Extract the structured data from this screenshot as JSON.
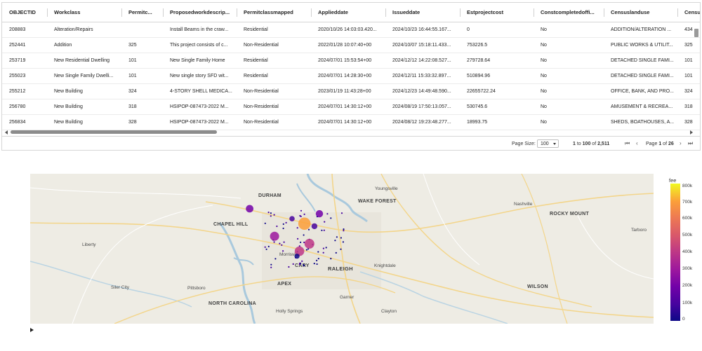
{
  "grid": {
    "columns": [
      "OBJECTID",
      "Workclass",
      "Permitc...",
      "Proposedworkdescrip...",
      "Permitclassmapped",
      "Applieddate",
      "Issueddate",
      "Estprojectcost",
      "Constcompletedoffi...",
      "Censuslanduse",
      "Censusl"
    ],
    "rows": [
      [
        "208883",
        "Alteration/Repairs",
        "",
        "Install Beams in the craw...",
        "Residential",
        "2020/10/26 14:03:03.420...",
        "2024/10/23 16:44:55.167...",
        "0",
        "No",
        "ADDITION/ALTERATION ...",
        "434"
      ],
      [
        "252441",
        "Addition",
        "325",
        "This project consists of c...",
        "Non-Residential",
        "2022/01/28 10:07:40+00",
        "2024/10/07 15:18:11.433...",
        "753226.5",
        "No",
        "PUBLIC WORKS & UTILIT...",
        "325"
      ],
      [
        "253719",
        "New Residential Dwelling",
        "101",
        "New Single Family Home",
        "Residential",
        "2024/07/01 15:53:54+00",
        "2024/12/12 14:22:08.527...",
        "279728.64",
        "No",
        "DETACHED SINGLE FAMI...",
        "101"
      ],
      [
        "255023",
        "New Single Family Dwelli...",
        "101",
        "New single story SFD wit...",
        "Residential",
        "2024/07/01 14:28:30+00",
        "2024/12/11 15:33:32.897...",
        "510894.96",
        "No",
        "DETACHED SINGLE FAMI...",
        "101"
      ],
      [
        "255212",
        "New Building",
        "324",
        "4-STORY SHELL MEDICA...",
        "Non-Residential",
        "2023/01/19 11:43:28+00",
        "2024/12/23 14:49:48.590...",
        "22655722.24",
        "No",
        "OFFICE, BANK, AND PRO...",
        "324"
      ],
      [
        "256780",
        "New Building",
        "318",
        "HSIPOP-087473-2022 M...",
        "Non-Residential",
        "2024/07/01 14:30:12+00",
        "2024/08/19 17:50:13.057...",
        "530745.6",
        "No",
        "AMUSEMENT & RECREA...",
        "318"
      ],
      [
        "256834",
        "New Building",
        "328",
        "HSIPOP-087473-2022 M...",
        "Non-Residential",
        "2024/07/01 14:30:12+00",
        "2024/08/12 19:23:48.277...",
        "18993.75",
        "No",
        "SHEDS, BOATHOUSES, A...",
        "328"
      ]
    ],
    "pager": {
      "page_size_label": "Page Size:",
      "page_size_value": "100",
      "range_from": "1",
      "range_to": "100",
      "range_of_word": "of",
      "range_to_word": "to",
      "total": "2,511",
      "page_word": "Page",
      "page_current": "1",
      "page_of_word": "of",
      "page_total": "26"
    }
  },
  "map": {
    "labels": {
      "durham": "DURHAM",
      "wake_forest": "WAKE FOREST",
      "youngsville": "Youngsville",
      "nashville": "Nashville",
      "rocky_mount": "ROCKY MOUNT",
      "tarboro": "Tarboro",
      "chapel_hill": "CHAPEL HILL",
      "liberty": "Liberty",
      "morrisville": "Morrisville",
      "cary": "CARY",
      "raleigh": "RALEIGH",
      "knightdale": "Knightdale",
      "apex": "APEX",
      "siler_city": "Siler City",
      "pittsboro": "Pittsboro",
      "wilson": "WILSON",
      "north_carolina": "NORTH CAROLINA",
      "holly_springs": "Holly Springs",
      "garner": "Garner",
      "clayton": "Clayton"
    },
    "points": [
      {
        "lon": -78.64,
        "lat": 35.85,
        "fee": 840000
      },
      {
        "lon": -78.86,
        "lat": 35.91,
        "fee": 210000
      },
      {
        "lon": -78.58,
        "lat": 35.89,
        "fee": 190000
      },
      {
        "lon": -78.76,
        "lat": 35.8,
        "fee": 380000
      },
      {
        "lon": -78.62,
        "lat": 35.77,
        "fee": 460000
      },
      {
        "lon": -78.66,
        "lat": 35.74,
        "fee": 420000
      },
      {
        "lon": -78.6,
        "lat": 35.84,
        "fee": 90000
      },
      {
        "lon": -78.69,
        "lat": 35.87,
        "fee": 60000
      },
      {
        "lon": -78.67,
        "lat": 35.72,
        "fee": 50000
      }
    ]
  },
  "colorbar": {
    "title": "fee",
    "ticks": [
      "800k",
      "700k",
      "600k",
      "500k",
      "400k",
      "300k",
      "200k",
      "100k",
      "0"
    ],
    "colors": [
      "#0d0887",
      "#46039f",
      "#7201a8",
      "#9c179e",
      "#bd3786",
      "#d8576b",
      "#ed7953",
      "#fb9f3a",
      "#f0f921"
    ]
  }
}
